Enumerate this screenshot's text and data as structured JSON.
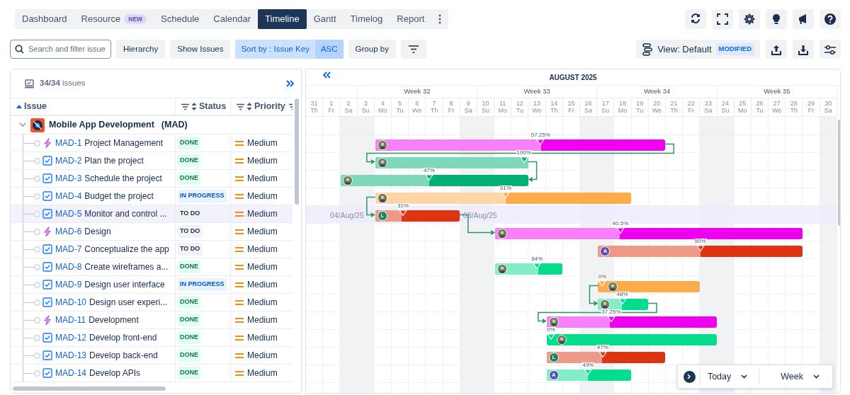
{
  "tabs": [
    {
      "label": "Dashboard",
      "selected": false
    },
    {
      "label": "Resource",
      "badge": "NEW",
      "selected": false
    },
    {
      "label": "Schedule",
      "selected": false
    },
    {
      "label": "Calendar",
      "selected": false
    },
    {
      "label": "Timeline",
      "selected": true
    },
    {
      "label": "Gantt",
      "selected": false
    },
    {
      "label": "Timelog",
      "selected": false
    },
    {
      "label": "Report",
      "selected": false
    }
  ],
  "toolbar": {
    "search": {
      "placeholder": "Search and filter issue"
    },
    "buttons": [
      "Hierarchy",
      "Show Issues"
    ],
    "sort": {
      "label": "Sort by : Issue Key",
      "order": "ASC",
      "selected": true
    },
    "group_by": "Group by",
    "view": {
      "label": "View: Default",
      "badge": "MODIFIED"
    }
  },
  "issues": {
    "count": "34/34",
    "count_label": "issues",
    "columns": [
      "Issue",
      "Status",
      "Priority"
    ],
    "group": {
      "name": "Mobile App Development",
      "key": "(MAD)",
      "expanded": true
    },
    "rows": [
      {
        "key": "MAD-1",
        "summary": "Project Management",
        "kind": "epic",
        "status": {
          "label": "DONE",
          "kind": "done"
        },
        "priority": "Medium",
        "selected": false,
        "dependency": {
          "kind": "finish-to-start"
        },
        "bar": {
          "level": 0.5725,
          "progress": "57.25%",
          "color": "#f000f0",
          "avatar": {
            "kind": "photo"
          }
        }
      },
      {
        "key": "MAD-2",
        "summary": "Plan the project",
        "kind": "task",
        "status": {
          "label": "DONE",
          "kind": "done"
        },
        "priority": "Medium",
        "selected": false,
        "dependency": {
          "kind": "finish-to-finish"
        },
        "bar": {
          "level": 1,
          "progress": "100%",
          "color": "#00b074",
          "avatar": {
            "kind": "photo"
          }
        }
      },
      {
        "key": "MAD-3",
        "summary": "Schedule the project",
        "kind": "task",
        "status": {
          "label": "DONE",
          "kind": "done"
        },
        "priority": "Medium",
        "selected": false,
        "bar": {
          "level": 0.47,
          "progress": "47%",
          "color": "#00b074",
          "avatar": {
            "kind": "photo"
          }
        }
      },
      {
        "key": "MAD-4",
        "summary": "Budget the project",
        "kind": "task",
        "status": {
          "label": "IN PROGRESS",
          "kind": "in_progress"
        },
        "priority": "Medium",
        "selected": false,
        "dependency": {
          "kind": "start-to-start"
        },
        "bar": {
          "level": 0.51,
          "progress": "51%",
          "color": "#fdab4b",
          "avatar": {
            "kind": "photo"
          }
        }
      },
      {
        "key": "MAD-5",
        "summary": "Monitor and control ...",
        "kind": "task",
        "status": {
          "label": "TO DO",
          "kind": "todo"
        },
        "priority": "Medium",
        "selected": true,
        "dependency": {
          "kind": "finish-to-start"
        },
        "bar": {
          "level": 0.31,
          "progress": "31%",
          "color": "#de3412",
          "start_label": "04/Aug/25",
          "end_label": "08/Aug/25",
          "avatar": {
            "kind": "letter",
            "letter": "L",
            "color": "#1f845a"
          }
        }
      },
      {
        "key": "MAD-6",
        "summary": "Design",
        "kind": "epic",
        "status": {
          "label": "TO DO",
          "kind": "todo"
        },
        "priority": "Medium",
        "selected": false,
        "bar": {
          "level": 0.405,
          "progress": "40.5%",
          "color": "#f000f0",
          "avatar": {
            "kind": "photo"
          }
        }
      },
      {
        "key": "MAD-7",
        "summary": "Conceptualize the app",
        "kind": "task",
        "status": {
          "label": "TO DO",
          "kind": "todo"
        },
        "priority": "Medium",
        "selected": false,
        "bar": {
          "level": 0.5,
          "progress": "50%",
          "color": "#de3412",
          "avatar": {
            "kind": "letter",
            "letter": "A",
            "color": "#5e4db2"
          }
        }
      },
      {
        "key": "MAD-8",
        "summary": "Create wireframes a...",
        "kind": "task",
        "status": {
          "label": "DONE",
          "kind": "done"
        },
        "priority": "Medium",
        "selected": false,
        "bar": {
          "level": 0.64,
          "progress": "64%",
          "color": "#05dc8e",
          "avatar": {
            "kind": "photo"
          }
        }
      },
      {
        "key": "MAD-9",
        "summary": "Design user interface",
        "kind": "task",
        "status": {
          "label": "IN PROGRESS",
          "kind": "in_progress"
        },
        "priority": "Medium",
        "selected": false,
        "dependency": {
          "kind": "start-to-start"
        },
        "bar": {
          "level": 0,
          "progress": "0%",
          "color": "#fdab4b",
          "avatar": {
            "kind": "photo"
          }
        }
      },
      {
        "key": "MAD-10",
        "summary": "Design user experi...",
        "kind": "task",
        "status": {
          "label": "DONE",
          "kind": "done"
        },
        "priority": "Medium",
        "selected": false,
        "dependency": {
          "kind": "finish-to-start"
        },
        "bar": {
          "level": 0.48,
          "progress": "48%",
          "color": "#05dc8e",
          "avatar": {
            "kind": "photo"
          }
        }
      },
      {
        "key": "MAD-11",
        "summary": "Development",
        "kind": "epic",
        "status": {
          "label": "DONE",
          "kind": "done"
        },
        "priority": "Medium",
        "selected": false,
        "bar": {
          "level": 0.3725,
          "progress": "37.25%",
          "color": "#f000f0",
          "avatar": {
            "kind": "photo"
          }
        }
      },
      {
        "key": "MAD-12",
        "summary": "Develop front-end",
        "kind": "task",
        "status": {
          "label": "DONE",
          "kind": "done"
        },
        "priority": "Medium",
        "selected": false,
        "bar": {
          "level": 0,
          "progress": "0%",
          "color": "#05dc8e",
          "avatar": {
            "kind": "photo"
          }
        }
      },
      {
        "key": "MAD-13",
        "summary": "Develop back-end",
        "kind": "task",
        "status": {
          "label": "DONE",
          "kind": "done"
        },
        "priority": "Medium",
        "selected": false,
        "bar": {
          "level": 0.47,
          "progress": "47%",
          "color": "#de3412",
          "avatar": {
            "kind": "letter",
            "letter": "L",
            "color": "#1f845a"
          }
        }
      },
      {
        "key": "MAD-14",
        "summary": "Develop APIs",
        "kind": "task",
        "status": {
          "label": "DONE",
          "kind": "done"
        },
        "priority": "Medium",
        "selected": false,
        "bar": {
          "level": 0.49,
          "progress": "49%",
          "color": "#05dc8e",
          "avatar": {
            "kind": "letter",
            "letter": "A",
            "color": "#5e4db2"
          }
        }
      }
    ]
  },
  "timeline": {
    "month": "AUGUST 2025",
    "weeks": [
      {
        "days": [
          {
            "date": "31",
            "weekday": "Th",
            "weekend": false
          },
          {
            "date": "1",
            "weekday": "Fr",
            "weekend": false
          },
          {
            "date": "2",
            "weekday": "Sa",
            "weekend": true
          }
        ]
      },
      {
        "label": "Week 32",
        "days": [
          {
            "date": "3",
            "weekday": "Su",
            "weekend": true
          },
          {
            "date": "4",
            "weekday": "Mo",
            "weekend": false
          },
          {
            "date": "5",
            "weekday": "Tu",
            "weekend": false
          },
          {
            "date": "6",
            "weekday": "We",
            "weekend": false
          },
          {
            "date": "7",
            "weekday": "Th",
            "weekend": false
          },
          {
            "date": "8",
            "weekday": "Fr",
            "weekend": false
          },
          {
            "date": "9",
            "weekday": "Sa",
            "weekend": true
          }
        ]
      },
      {
        "label": "Week 33",
        "days": [
          {
            "date": "10",
            "weekday": "Su",
            "weekend": true
          },
          {
            "date": "11",
            "weekday": "Mo",
            "weekend": false
          },
          {
            "date": "12",
            "weekday": "Tu",
            "weekend": false
          },
          {
            "date": "13",
            "weekday": "We",
            "weekend": false
          },
          {
            "date": "14",
            "weekday": "Th",
            "weekend": false
          },
          {
            "date": "15",
            "weekday": "Fr",
            "weekend": false
          },
          {
            "date": "16",
            "weekday": "Sa",
            "weekend": true
          }
        ]
      },
      {
        "label": "Week 34",
        "days": [
          {
            "date": "17",
            "weekday": "Su",
            "weekend": true
          },
          {
            "date": "18",
            "weekday": "Mo",
            "weekend": false
          },
          {
            "date": "19",
            "weekday": "Tu",
            "weekend": false
          },
          {
            "date": "20",
            "weekday": "We",
            "weekend": false
          },
          {
            "date": "21",
            "weekday": "Th",
            "weekend": false
          },
          {
            "date": "22",
            "weekday": "Fr",
            "weekend": false
          },
          {
            "date": "23",
            "weekday": "Sa",
            "weekend": true
          }
        ]
      },
      {
        "label": "Week 35",
        "days": [
          {
            "date": "24",
            "weekday": "Su",
            "weekend": true
          },
          {
            "date": "25",
            "weekday": "Mo",
            "weekend": false
          },
          {
            "date": "26",
            "weekday": "Tu",
            "weekend": false
          },
          {
            "date": "27",
            "weekday": "We",
            "weekend": false
          },
          {
            "date": "28",
            "weekday": "Th",
            "weekend": false
          },
          {
            "date": "29",
            "weekday": "Fr",
            "weekend": false
          },
          {
            "date": "30",
            "weekday": "Sa",
            "weekend": true
          }
        ]
      }
    ]
  },
  "controls": {
    "today": "Today",
    "scale": "Week"
  }
}
